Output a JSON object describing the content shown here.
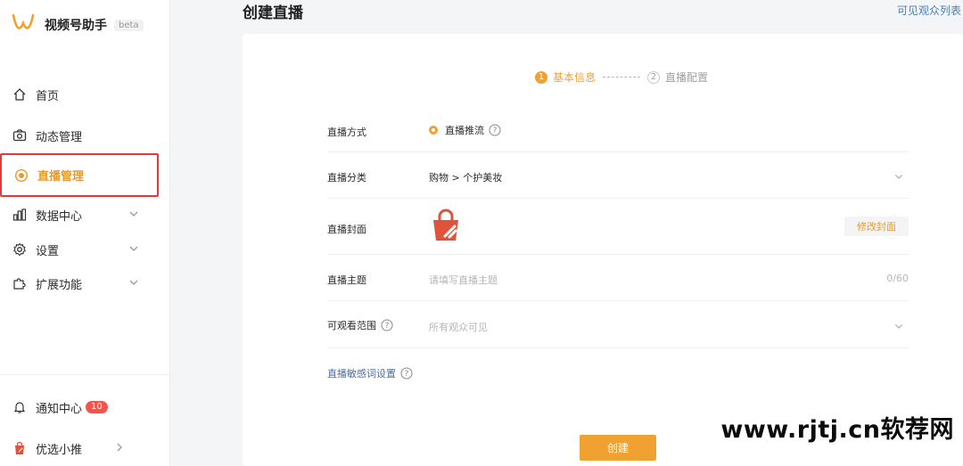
{
  "brand": {
    "name": "视频号助手",
    "badge": "beta"
  },
  "nav": {
    "home": "首页",
    "moments": "动态管理",
    "live": "直播管理",
    "data": "数据中心",
    "settings": "设置",
    "extensions": "扩展功能",
    "notifications": "通知中心",
    "notifications_count": "10",
    "promote": "优选小推"
  },
  "header": {
    "title": "创建直播",
    "right_link": "可见观众列表"
  },
  "steps": [
    {
      "num": "1",
      "label": "基本信息"
    },
    {
      "num": "2",
      "label": "直播配置"
    }
  ],
  "form": {
    "method_label": "直播方式",
    "method_value": "直播推流",
    "category_label": "直播分类",
    "category_value": "购物 > 个护美妆",
    "cover_label": "直播封面",
    "cover_button": "修改封面",
    "topic_label": "直播主题",
    "topic_placeholder": "请填写直播主题",
    "topic_counter": "0/60",
    "scope_label": "可观看范围",
    "scope_value": "所有观众可见",
    "sensitive_link": "直播敏感词设置"
  },
  "create_button": "创建",
  "watermark": "www.rjtj.cn软荐网",
  "colors": {
    "accent": "#f0a132",
    "active_border": "#e4393c",
    "link": "#4a7fb8"
  }
}
